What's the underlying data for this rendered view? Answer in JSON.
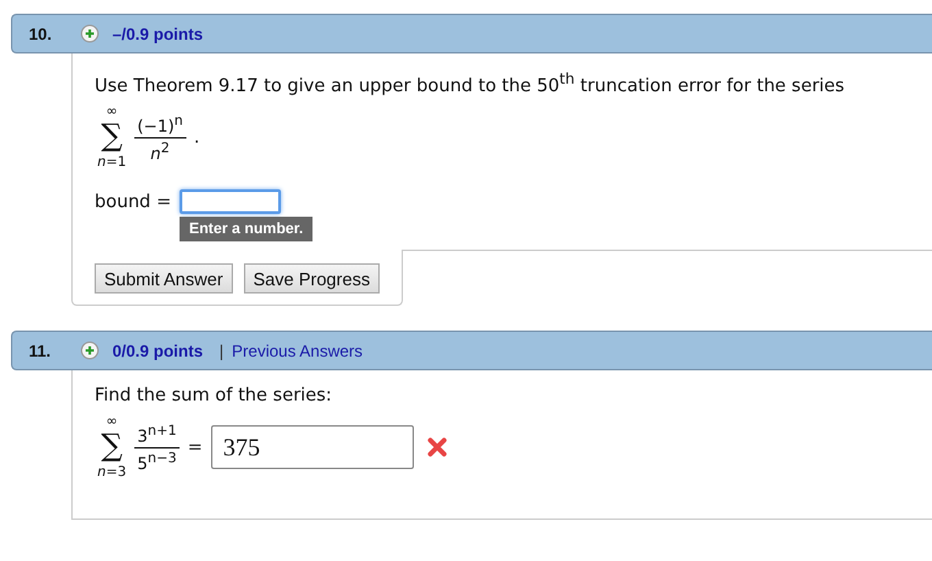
{
  "questions": [
    {
      "number": "10.",
      "points": "–/0.9 points",
      "prompt": "Use Theorem 9.17 to give an upper bound to the 50$^{th}$ truncation error for the series",
      "formula": {
        "sign": "∑",
        "upper": "∞",
        "lower": "*n*=1",
        "numerator": "(−1)$^{n}$",
        "denominator": "*n*$^{2}$",
        "trailing": "."
      },
      "answer": {
        "label": "bound =",
        "focused": true,
        "hint": "Enter a number.",
        "incorrect": false
      },
      "buttons": [
        "Submit Answer",
        "Save Progress"
      ]
    },
    {
      "number": "11.",
      "points": "0/0.9 points",
      "separator": "|",
      "link": "Previous Answers",
      "prompt": "Find the sum of the series:",
      "formula": {
        "sign": "∑",
        "upper": "∞",
        "lower": "*n*=3",
        "numerator": "3$^{n+1}$",
        "denominator": "5$^{n−3}$"
      },
      "answer": {
        "label": "=",
        "value": "375",
        "focused": false,
        "incorrect": true
      }
    }
  ]
}
